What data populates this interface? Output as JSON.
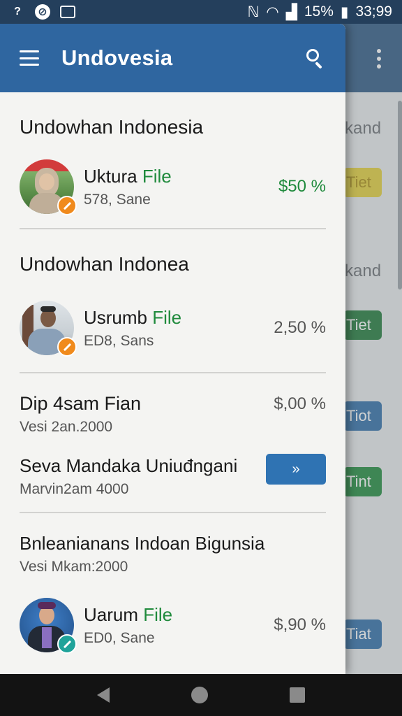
{
  "status_bar": {
    "left_icons": [
      "help-icon",
      "location-off-icon",
      "screenshot-icon"
    ],
    "battery": "15%",
    "time": "33;99"
  },
  "background": {
    "labels": [
      "kand",
      "kand"
    ],
    "chips": [
      {
        "label": "Tiet",
        "color": "#e3cf3a"
      },
      {
        "label": "Tiet",
        "color": "#1f7a3a"
      },
      {
        "label": "Tiot",
        "color": "#2f6ea8"
      },
      {
        "label": "Tint",
        "color": "#1f8a3c"
      },
      {
        "label": "Tiat",
        "color": "#2f6ea8"
      }
    ]
  },
  "app_bar": {
    "title": "Undovesia"
  },
  "sections": [
    {
      "title": "Undowhan Indonesia",
      "item": {
        "name": "Uktura",
        "name_highlight": "File",
        "sub": "578, Sane",
        "amount": "$50 %",
        "amount_color": "green",
        "badge_color": "#f08a1c"
      }
    },
    {
      "title": "Undowhan Indonea",
      "item": {
        "name": "Usrumb",
        "name_highlight": "File",
        "sub": "ED8, Sans",
        "amount": "2,50 %",
        "amount_color": "gray",
        "badge_color": "#f08a1c"
      }
    }
  ],
  "plain_items": [
    {
      "title": "Dip 4sam Fian",
      "sub": "Vesi 2an.2000",
      "amount": "$,00 %"
    },
    {
      "title": "Seva Mandaka Uniuđngani",
      "sub": "Marvin2am 4000",
      "button_icon": "chevron-right-icon"
    }
  ],
  "last_section": {
    "title": "Bnleanianans Indoan Bigunsia",
    "sub": "Vesi Mkam:2000",
    "item": {
      "name": "Uarum",
      "name_highlight": "File",
      "sub": "ED0, Sane",
      "amount": "$,90 %",
      "amount_color": "gray",
      "badge_color": "#1fa39a"
    }
  }
}
